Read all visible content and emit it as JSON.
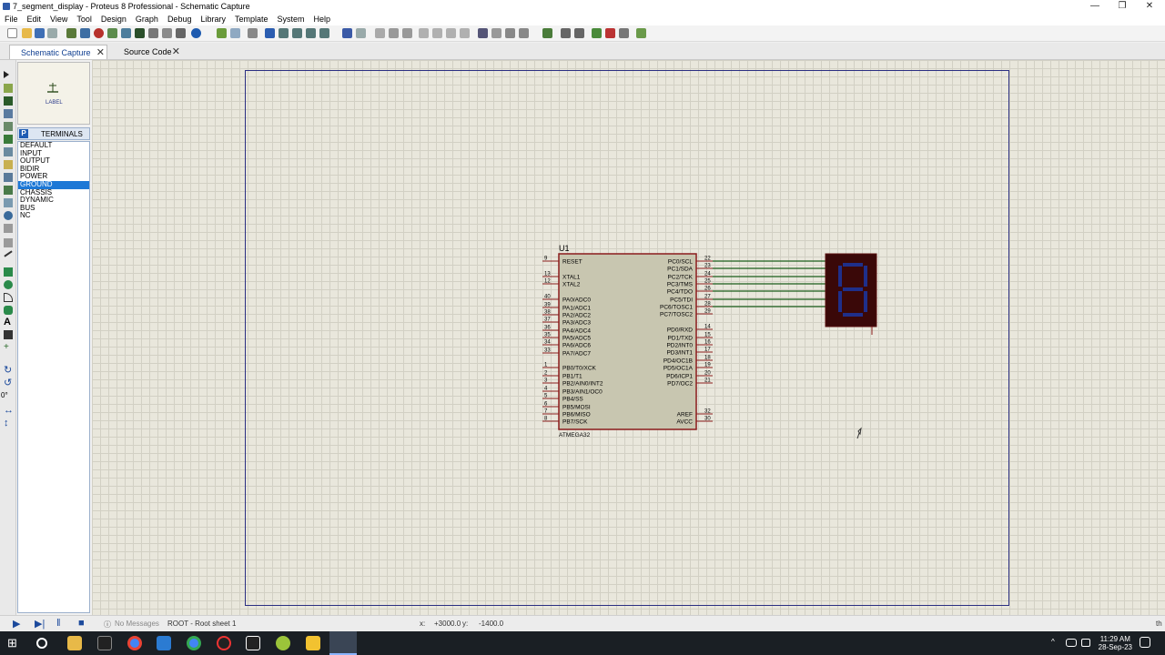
{
  "window": {
    "title": "7_segment_display - Proteus 8 Professional - Schematic Capture",
    "minimize": "—",
    "restore": "❐",
    "close": "✕"
  },
  "menu": [
    "File",
    "Edit",
    "View",
    "Tool",
    "Design",
    "Graph",
    "Debug",
    "Library",
    "Template",
    "System",
    "Help"
  ],
  "tabs": [
    {
      "label": "Schematic Capture",
      "close": "✕"
    },
    {
      "label": "Source Code",
      "close": "✕"
    }
  ],
  "preview": {
    "label": "LABEL"
  },
  "terminals": {
    "badge": "P",
    "header": "TERMINALS",
    "items": [
      "DEFAULT",
      "INPUT",
      "OUTPUT",
      "BIDIR",
      "POWER",
      "GROUND",
      "CHASSIS",
      "DYNAMIC",
      "BUS",
      "NC"
    ],
    "selected": "GROUND"
  },
  "rotation": {
    "value": "0°"
  },
  "chip": {
    "ref": "U1",
    "part": "ATMEGA32",
    "left_pins": [
      {
        "num": "9",
        "name": "RESET"
      },
      {
        "num": "13",
        "name": "XTAL1"
      },
      {
        "num": "12",
        "name": "XTAL2"
      },
      {
        "num": "40",
        "name": "PA0/ADC0"
      },
      {
        "num": "39",
        "name": "PA1/ADC1"
      },
      {
        "num": "38",
        "name": "PA2/ADC2"
      },
      {
        "num": "37",
        "name": "PA3/ADC3"
      },
      {
        "num": "36",
        "name": "PA4/ADC4"
      },
      {
        "num": "35",
        "name": "PA5/ADC5"
      },
      {
        "num": "34",
        "name": "PA6/ADC6"
      },
      {
        "num": "33",
        "name": "PA7/ADC7"
      },
      {
        "num": "1",
        "name": "PB0/T0/XCK"
      },
      {
        "num": "2",
        "name": "PB1/T1"
      },
      {
        "num": "3",
        "name": "PB2/AIN0/INT2"
      },
      {
        "num": "4",
        "name": "PB3/AIN1/OC0"
      },
      {
        "num": "5",
        "name": "PB4/SS"
      },
      {
        "num": "6",
        "name": "PB5/MOSI"
      },
      {
        "num": "7",
        "name": "PB6/MISO"
      },
      {
        "num": "8",
        "name": "PB7/SCK"
      }
    ],
    "right_pins": [
      {
        "num": "22",
        "name": "PC0/SCL"
      },
      {
        "num": "23",
        "name": "PC1/SDA"
      },
      {
        "num": "24",
        "name": "PC2/TCK"
      },
      {
        "num": "25",
        "name": "PC3/TMS"
      },
      {
        "num": "26",
        "name": "PC4/TDO"
      },
      {
        "num": "27",
        "name": "PC5/TDI"
      },
      {
        "num": "28",
        "name": "PC6/TOSC1"
      },
      {
        "num": "29",
        "name": "PC7/TOSC2"
      },
      {
        "num": "14",
        "name": "PD0/RXD"
      },
      {
        "num": "15",
        "name": "PD1/TXD"
      },
      {
        "num": "16",
        "name": "PD2/INT0"
      },
      {
        "num": "17",
        "name": "PD3/INT1"
      },
      {
        "num": "18",
        "name": "PD4/OC1B"
      },
      {
        "num": "19",
        "name": "PD5/OC1A"
      },
      {
        "num": "20",
        "name": "PD6/ICP1"
      },
      {
        "num": "21",
        "name": "PD7/OC2"
      },
      {
        "num": "32",
        "name": "AREF"
      },
      {
        "num": "30",
        "name": "AVCC"
      }
    ]
  },
  "display": {
    "digit": "8"
  },
  "status": {
    "messages": "No Messages",
    "sheet": "ROOT - Root sheet 1",
    "x_label": "x:",
    "x_value": "+3000.0",
    "y_label": "y:",
    "y_value": "-1400.0",
    "edge": "th"
  },
  "taskbar": {
    "time": "11:29 AM",
    "date": "28-Sep-23"
  },
  "colors": {
    "wire": "#1b5e1b",
    "chip_fill": "#c8c6b0",
    "chip_border": "#8a1c1c",
    "display_bg": "#3a0808",
    "segment": "#1f2f8a"
  }
}
